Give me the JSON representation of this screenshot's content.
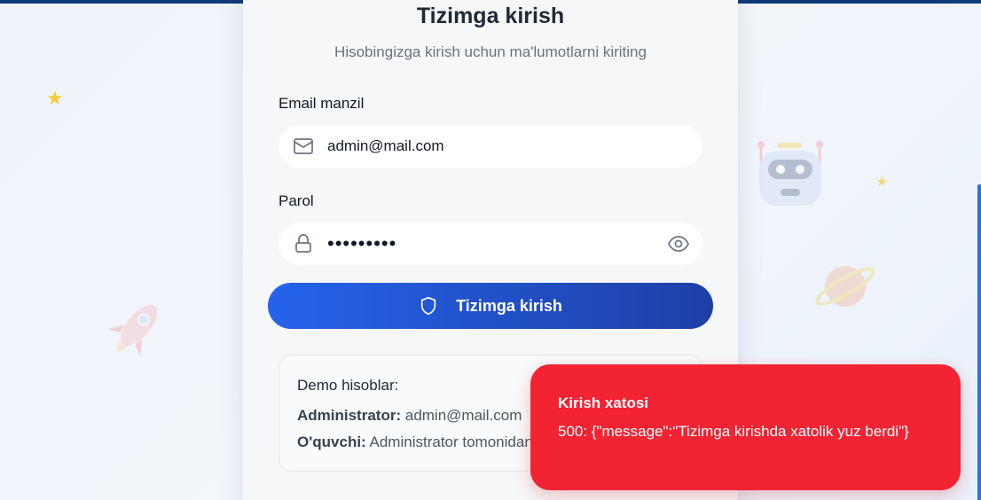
{
  "login": {
    "title": "Tizimga kirish",
    "subtitle": "Hisobingizga kirish uchun ma'lumotlarni kiriting",
    "email_label": "Email manzil",
    "email_value": "admin@mail.com",
    "password_label": "Parol",
    "password_value": "•••••••••",
    "submit_label": "Tizimga kirish"
  },
  "demo": {
    "title": "Demo hisoblar:",
    "admin_label": "Administrator:",
    "admin_value": "admin@mail.com",
    "student_label": "O'quvchi:",
    "student_value": "Administrator tomonidan"
  },
  "toast": {
    "title": "Kirish xatosi",
    "message": "500: {\"message\":\"Tizimga kirishda xatolik yuz berdi\"}"
  },
  "icons": {
    "email": "mail-icon",
    "password": "lock-icon",
    "toggle": "eye-icon",
    "submit": "shield-icon"
  },
  "colors": {
    "primary": "#2563eb",
    "primary_dark": "#1e3fa6",
    "error": "#f22333",
    "star": "#f5cc3e"
  }
}
